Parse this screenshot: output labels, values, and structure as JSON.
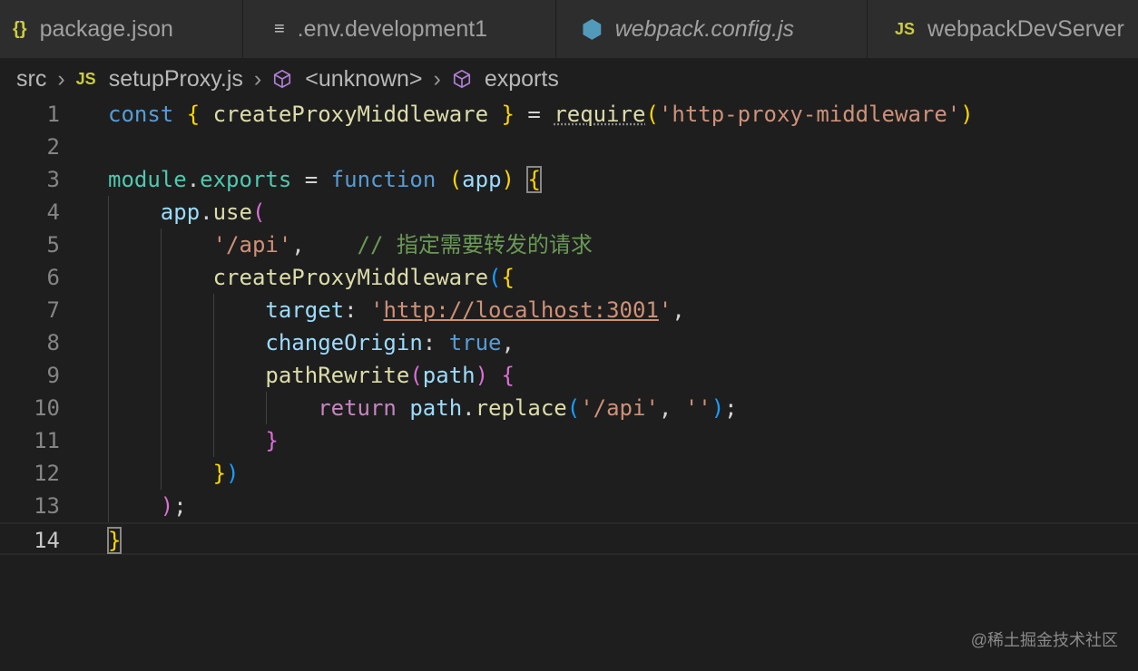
{
  "tabs": [
    {
      "label": "package.json",
      "icon": "{}",
      "icon_color": "#cbcb41"
    },
    {
      "label": ".env.development1",
      "icon": "≡",
      "icon_color": "#c5c5c5"
    },
    {
      "label": "webpack.config.js",
      "icon": "⬢",
      "icon_color": "#519aba"
    },
    {
      "label": "webpackDevServer",
      "icon": "JS",
      "icon_color": "#cbcb41"
    }
  ],
  "breadcrumb": {
    "folder": "src",
    "file_icon": "JS",
    "file": "setupProxy.js",
    "symbol1": "<unknown>",
    "symbol2": "exports"
  },
  "code": {
    "lines": [
      {
        "n": "1",
        "t": [
          [
            "const",
            "kw"
          ],
          [
            " "
          ],
          [
            "{",
            "gold"
          ],
          [
            " createProxyMiddleware ",
            "fn"
          ],
          [
            "}",
            "gold"
          ],
          [
            " = "
          ],
          [
            "require",
            "fn dots"
          ],
          [
            "(",
            "gold"
          ],
          [
            "'http-proxy-middleware'",
            "str"
          ],
          [
            ")",
            "gold"
          ]
        ]
      },
      {
        "n": "2",
        "t": []
      },
      {
        "n": "3",
        "t": [
          [
            "module",
            "tl"
          ],
          [
            "."
          ],
          [
            "exports",
            "tl"
          ],
          [
            " = "
          ],
          [
            "function",
            "kw"
          ],
          [
            " "
          ],
          [
            "(",
            "gold"
          ],
          [
            "app",
            "var"
          ],
          [
            ")",
            "gold"
          ],
          [
            " "
          ],
          [
            "{",
            "gold box"
          ]
        ]
      },
      {
        "n": "4",
        "t": [
          [
            "    "
          ],
          [
            "app",
            "var"
          ],
          [
            "."
          ],
          [
            "use",
            "fn"
          ],
          [
            "(",
            "pur"
          ]
        ]
      },
      {
        "n": "5",
        "t": [
          [
            "        "
          ],
          [
            "'/api'",
            "str"
          ],
          [
            ",    "
          ],
          [
            "// 指定需要转发的请求",
            "cm"
          ]
        ]
      },
      {
        "n": "6",
        "t": [
          [
            "        "
          ],
          [
            "createProxyMiddleware",
            "fn"
          ],
          [
            "(",
            "blu"
          ],
          [
            "{",
            "gold"
          ]
        ]
      },
      {
        "n": "7",
        "t": [
          [
            "            "
          ],
          [
            "target",
            "var"
          ],
          [
            ": "
          ],
          [
            "'",
            "str"
          ],
          [
            "http://localhost:3001",
            "str ul"
          ],
          [
            "'",
            "str"
          ],
          [
            ","
          ]
        ]
      },
      {
        "n": "8",
        "t": [
          [
            "            "
          ],
          [
            "changeOrigin",
            "var"
          ],
          [
            ": "
          ],
          [
            "true",
            "kw"
          ],
          [
            ","
          ]
        ]
      },
      {
        "n": "9",
        "t": [
          [
            "            "
          ],
          [
            "pathRewrite",
            "fn"
          ],
          [
            "(",
            "pur"
          ],
          [
            "path",
            "var"
          ],
          [
            ")",
            "pur"
          ],
          [
            " "
          ],
          [
            "{",
            "pur"
          ]
        ]
      },
      {
        "n": "10",
        "t": [
          [
            "                "
          ],
          [
            "return",
            "ctl"
          ],
          [
            " "
          ],
          [
            "path",
            "var"
          ],
          [
            "."
          ],
          [
            "replace",
            "fn"
          ],
          [
            "(",
            "blu"
          ],
          [
            "'/api'",
            "str"
          ],
          [
            ", "
          ],
          [
            "''",
            "str"
          ],
          [
            ")",
            "blu"
          ],
          [
            ";"
          ]
        ]
      },
      {
        "n": "11",
        "t": [
          [
            "            "
          ],
          [
            "}",
            "pur"
          ]
        ]
      },
      {
        "n": "12",
        "t": [
          [
            "        "
          ],
          [
            "}",
            "gold"
          ],
          [
            ")",
            "blu"
          ]
        ]
      },
      {
        "n": "13",
        "t": [
          [
            "    "
          ],
          [
            ")",
            "pur"
          ],
          [
            ";"
          ]
        ]
      },
      {
        "n": "14",
        "t": [
          [
            "}",
            "gold box"
          ]
        ]
      }
    ]
  },
  "watermark": "@稀土掘金技术社区"
}
